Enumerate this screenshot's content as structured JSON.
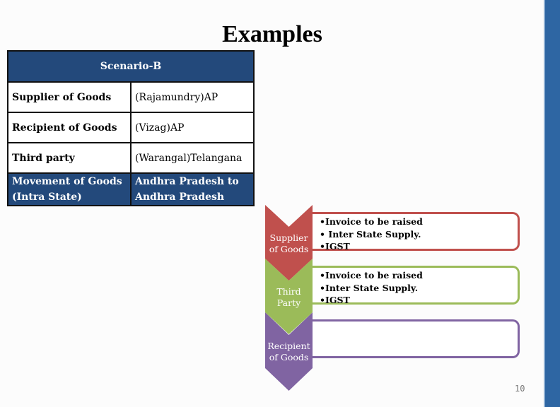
{
  "slide": {
    "title": "Examples",
    "page_number": "10"
  },
  "table": {
    "header": "Scenario-B",
    "rows": [
      {
        "label": "Supplier of Goods",
        "value": "(Rajamundry)AP"
      },
      {
        "label": "Recipient of Goods",
        "value": "(Vizag)AP"
      },
      {
        "label": "Third party",
        "value": "(Warangal)Telangana"
      }
    ],
    "movement": {
      "label_line1": "Movement of Goods",
      "label_line2": "(Intra State)",
      "value_line1": "Andhra Pradesh to",
      "value_line2": "Andhra Pradesh"
    }
  },
  "process": {
    "steps": [
      {
        "label_line1": "Supplier",
        "label_line2": "of Goods",
        "color": "#c0504d",
        "bullets": [
          "Invoice to be raised",
          " Inter State Supply.",
          "IGST"
        ]
      },
      {
        "label_line1": "Third",
        "label_line2": "Party",
        "color": "#9bbb59",
        "bullets": [
          "Invoice to be raised",
          "Inter State Supply.",
          "IGST"
        ]
      },
      {
        "label_line1": "Recipient",
        "label_line2": "of Goods",
        "color": "#8064a2",
        "bullets": []
      }
    ]
  },
  "colors": {
    "table_header": "#23497b",
    "side_bar": "#2e66a3"
  }
}
